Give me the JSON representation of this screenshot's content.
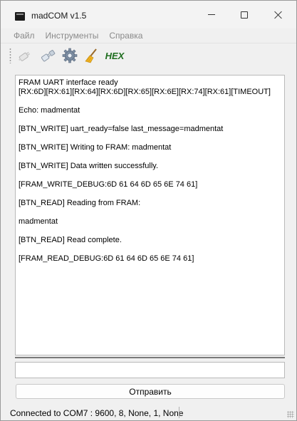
{
  "window": {
    "title": "madCOM v1.5"
  },
  "menu": {
    "items": [
      "Файл",
      "Инструменты",
      "Справка"
    ]
  },
  "toolbar": {
    "buttons": [
      {
        "icon": "connect-plug-icon"
      },
      {
        "icon": "disconnect-plug-icon"
      },
      {
        "icon": "settings-gear-icon"
      },
      {
        "icon": "clear-broom-icon"
      }
    ],
    "hex_label": "HEX",
    "colors": {
      "hex": "#1f6e1f"
    }
  },
  "log": {
    "lines": [
      "FRAM UART interface ready",
      "[RX:6D][RX:61][RX:64][RX:6D][RX:65][RX:6E][RX:74][RX:61][TIMEOUT]",
      "",
      "Echo: madmentat",
      "",
      "[BTN_WRITE] uart_ready=false last_message=madmentat",
      "",
      "[BTN_WRITE] Writing to FRAM: madmentat",
      "",
      "[BTN_WRITE] Data written successfully.",
      "",
      "[FRAM_WRITE_DEBUG:6D 61 64 6D 65 6E 74 61]",
      "",
      "[BTN_READ] Reading from FRAM:",
      "",
      "madmentat",
      "",
      "[BTN_READ] Read complete.",
      "",
      "[FRAM_READ_DEBUG:6D 61 64 6D 65 6E 74 61]"
    ]
  },
  "input": {
    "value": "",
    "placeholder": ""
  },
  "send_button": {
    "label": "Отправить"
  },
  "status": {
    "text": "Connected to COM7 : 9600, 8, None, 1, None"
  }
}
